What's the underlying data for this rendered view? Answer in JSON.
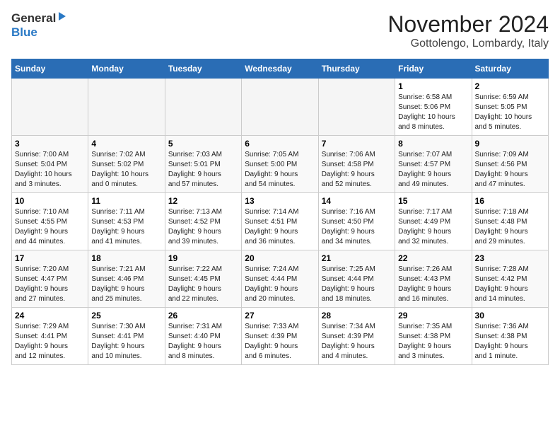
{
  "header": {
    "logo": {
      "line1": "General",
      "line2": "Blue"
    },
    "title": "November 2024",
    "subtitle": "Gottolengo, Lombardy, Italy"
  },
  "weekdays": [
    "Sunday",
    "Monday",
    "Tuesday",
    "Wednesday",
    "Thursday",
    "Friday",
    "Saturday"
  ],
  "weeks": [
    [
      {
        "day": "",
        "info": ""
      },
      {
        "day": "",
        "info": ""
      },
      {
        "day": "",
        "info": ""
      },
      {
        "day": "",
        "info": ""
      },
      {
        "day": "",
        "info": ""
      },
      {
        "day": "1",
        "info": "Sunrise: 6:58 AM\nSunset: 5:06 PM\nDaylight: 10 hours\nand 8 minutes."
      },
      {
        "day": "2",
        "info": "Sunrise: 6:59 AM\nSunset: 5:05 PM\nDaylight: 10 hours\nand 5 minutes."
      }
    ],
    [
      {
        "day": "3",
        "info": "Sunrise: 7:00 AM\nSunset: 5:04 PM\nDaylight: 10 hours\nand 3 minutes."
      },
      {
        "day": "4",
        "info": "Sunrise: 7:02 AM\nSunset: 5:02 PM\nDaylight: 10 hours\nand 0 minutes."
      },
      {
        "day": "5",
        "info": "Sunrise: 7:03 AM\nSunset: 5:01 PM\nDaylight: 9 hours\nand 57 minutes."
      },
      {
        "day": "6",
        "info": "Sunrise: 7:05 AM\nSunset: 5:00 PM\nDaylight: 9 hours\nand 54 minutes."
      },
      {
        "day": "7",
        "info": "Sunrise: 7:06 AM\nSunset: 4:58 PM\nDaylight: 9 hours\nand 52 minutes."
      },
      {
        "day": "8",
        "info": "Sunrise: 7:07 AM\nSunset: 4:57 PM\nDaylight: 9 hours\nand 49 minutes."
      },
      {
        "day": "9",
        "info": "Sunrise: 7:09 AM\nSunset: 4:56 PM\nDaylight: 9 hours\nand 47 minutes."
      }
    ],
    [
      {
        "day": "10",
        "info": "Sunrise: 7:10 AM\nSunset: 4:55 PM\nDaylight: 9 hours\nand 44 minutes."
      },
      {
        "day": "11",
        "info": "Sunrise: 7:11 AM\nSunset: 4:53 PM\nDaylight: 9 hours\nand 41 minutes."
      },
      {
        "day": "12",
        "info": "Sunrise: 7:13 AM\nSunset: 4:52 PM\nDaylight: 9 hours\nand 39 minutes."
      },
      {
        "day": "13",
        "info": "Sunrise: 7:14 AM\nSunset: 4:51 PM\nDaylight: 9 hours\nand 36 minutes."
      },
      {
        "day": "14",
        "info": "Sunrise: 7:16 AM\nSunset: 4:50 PM\nDaylight: 9 hours\nand 34 minutes."
      },
      {
        "day": "15",
        "info": "Sunrise: 7:17 AM\nSunset: 4:49 PM\nDaylight: 9 hours\nand 32 minutes."
      },
      {
        "day": "16",
        "info": "Sunrise: 7:18 AM\nSunset: 4:48 PM\nDaylight: 9 hours\nand 29 minutes."
      }
    ],
    [
      {
        "day": "17",
        "info": "Sunrise: 7:20 AM\nSunset: 4:47 PM\nDaylight: 9 hours\nand 27 minutes."
      },
      {
        "day": "18",
        "info": "Sunrise: 7:21 AM\nSunset: 4:46 PM\nDaylight: 9 hours\nand 25 minutes."
      },
      {
        "day": "19",
        "info": "Sunrise: 7:22 AM\nSunset: 4:45 PM\nDaylight: 9 hours\nand 22 minutes."
      },
      {
        "day": "20",
        "info": "Sunrise: 7:24 AM\nSunset: 4:44 PM\nDaylight: 9 hours\nand 20 minutes."
      },
      {
        "day": "21",
        "info": "Sunrise: 7:25 AM\nSunset: 4:44 PM\nDaylight: 9 hours\nand 18 minutes."
      },
      {
        "day": "22",
        "info": "Sunrise: 7:26 AM\nSunset: 4:43 PM\nDaylight: 9 hours\nand 16 minutes."
      },
      {
        "day": "23",
        "info": "Sunrise: 7:28 AM\nSunset: 4:42 PM\nDaylight: 9 hours\nand 14 minutes."
      }
    ],
    [
      {
        "day": "24",
        "info": "Sunrise: 7:29 AM\nSunset: 4:41 PM\nDaylight: 9 hours\nand 12 minutes."
      },
      {
        "day": "25",
        "info": "Sunrise: 7:30 AM\nSunset: 4:41 PM\nDaylight: 9 hours\nand 10 minutes."
      },
      {
        "day": "26",
        "info": "Sunrise: 7:31 AM\nSunset: 4:40 PM\nDaylight: 9 hours\nand 8 minutes."
      },
      {
        "day": "27",
        "info": "Sunrise: 7:33 AM\nSunset: 4:39 PM\nDaylight: 9 hours\nand 6 minutes."
      },
      {
        "day": "28",
        "info": "Sunrise: 7:34 AM\nSunset: 4:39 PM\nDaylight: 9 hours\nand 4 minutes."
      },
      {
        "day": "29",
        "info": "Sunrise: 7:35 AM\nSunset: 4:38 PM\nDaylight: 9 hours\nand 3 minutes."
      },
      {
        "day": "30",
        "info": "Sunrise: 7:36 AM\nSunset: 4:38 PM\nDaylight: 9 hours\nand 1 minute."
      }
    ]
  ]
}
